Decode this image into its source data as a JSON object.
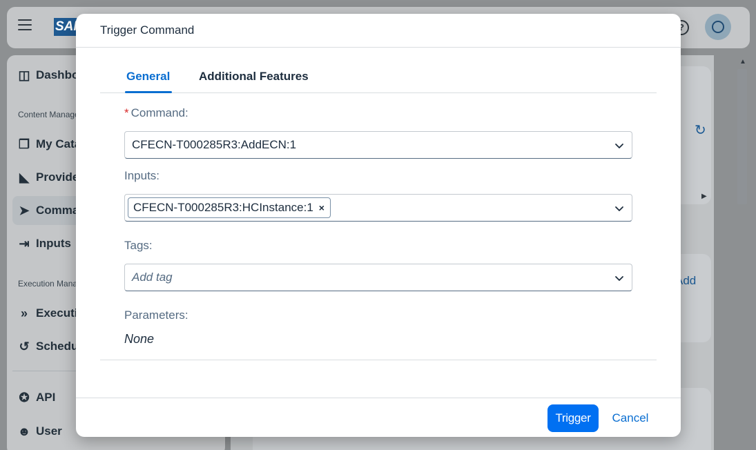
{
  "shell": {
    "logo_text": "SAP"
  },
  "sidebar": {
    "items": [
      {
        "label": "Dashboard",
        "icon": "dashboard-icon"
      },
      {
        "label": "My Catalog",
        "icon": "catalog-icon"
      },
      {
        "label": "Providers",
        "icon": "provider-icon"
      },
      {
        "label": "Commands",
        "icon": "command-icon"
      },
      {
        "label": "Inputs",
        "icon": "input-icon"
      },
      {
        "label": "Executions",
        "icon": "execution-icon"
      },
      {
        "label": "Schedules",
        "icon": "schedule-icon"
      },
      {
        "label": "API",
        "icon": "api-icon"
      },
      {
        "label": "User",
        "icon": "user-icon"
      }
    ],
    "groups": [
      "Content Management",
      "Execution Management"
    ]
  },
  "background": {
    "add_link": "Add"
  },
  "dialog": {
    "title": "Trigger Command",
    "tabs": [
      {
        "label": "General",
        "active": true
      },
      {
        "label": "Additional Features",
        "active": false
      }
    ],
    "command": {
      "label": "Command:",
      "required_marker": "*",
      "value": "CFECN-T000285R3:AddECN:1"
    },
    "inputs": {
      "label": "Inputs:",
      "tokens": [
        "CFECN-T000285R3:HCInstance:1"
      ],
      "token_remove": "×"
    },
    "tags": {
      "label": "Tags:",
      "placeholder": "Add tag"
    },
    "parameters": {
      "label": "Parameters:",
      "value": "None"
    },
    "footer": {
      "trigger_label": "Trigger",
      "cancel_label": "Cancel"
    }
  },
  "colors": {
    "accent": "#0a6ed1",
    "primary_button": "#0070f2",
    "required": "#d92c2c",
    "label": "#556b82",
    "overlay": "#8d9092"
  }
}
